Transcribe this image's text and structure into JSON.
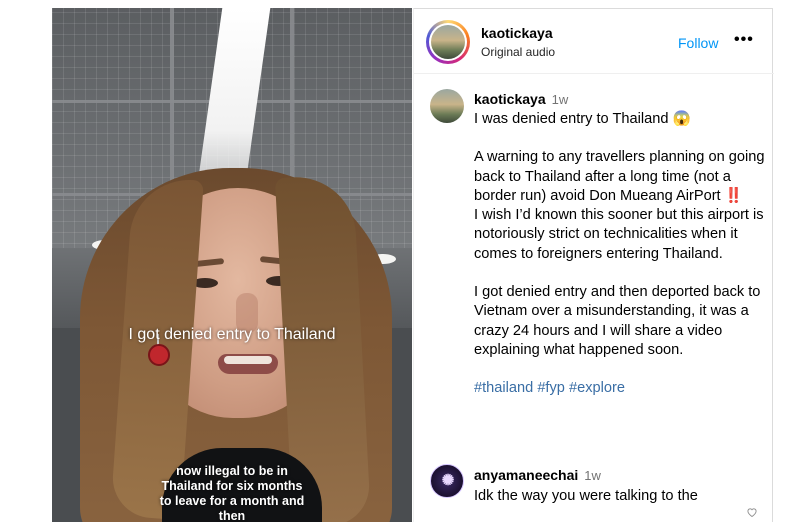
{
  "video": {
    "caption_main": "I got denied entry to Thailand",
    "caption_sub": [
      "now illegal to be in",
      "Thailand for six months",
      "to leave for a month and",
      "then"
    ]
  },
  "header": {
    "username": "kaotickaya",
    "audio": "Original audio",
    "follow_label": "Follow",
    "more_label": "•••"
  },
  "post": {
    "username": "kaotickaya",
    "time": "1w",
    "paragraphs": [
      "I was denied entry to Thailand 😱",
      "",
      "A warning to any travellers planning on going back to Thailand after a long time (not a border run) avoid Don Mueang AirPort ‼️",
      "I wish I’d known this sooner but this airport is notoriously strict on technicalities when it comes to foreigners entering Thailand.",
      "",
      "I got denied entry and then deported back to Vietnam over a misunderstanding, it was a crazy 24 hours and I will share a video explaining what happened soon.",
      ""
    ],
    "hashtags": [
      "#thailand",
      "#fyp",
      "#explore"
    ]
  },
  "comment": {
    "username": "anyamaneechai",
    "time": "1w",
    "text": "Idk the way you were talking to the"
  },
  "colors": {
    "accent": "#0095f6",
    "hashtag": "#3a6ea5",
    "muted": "#737373"
  }
}
